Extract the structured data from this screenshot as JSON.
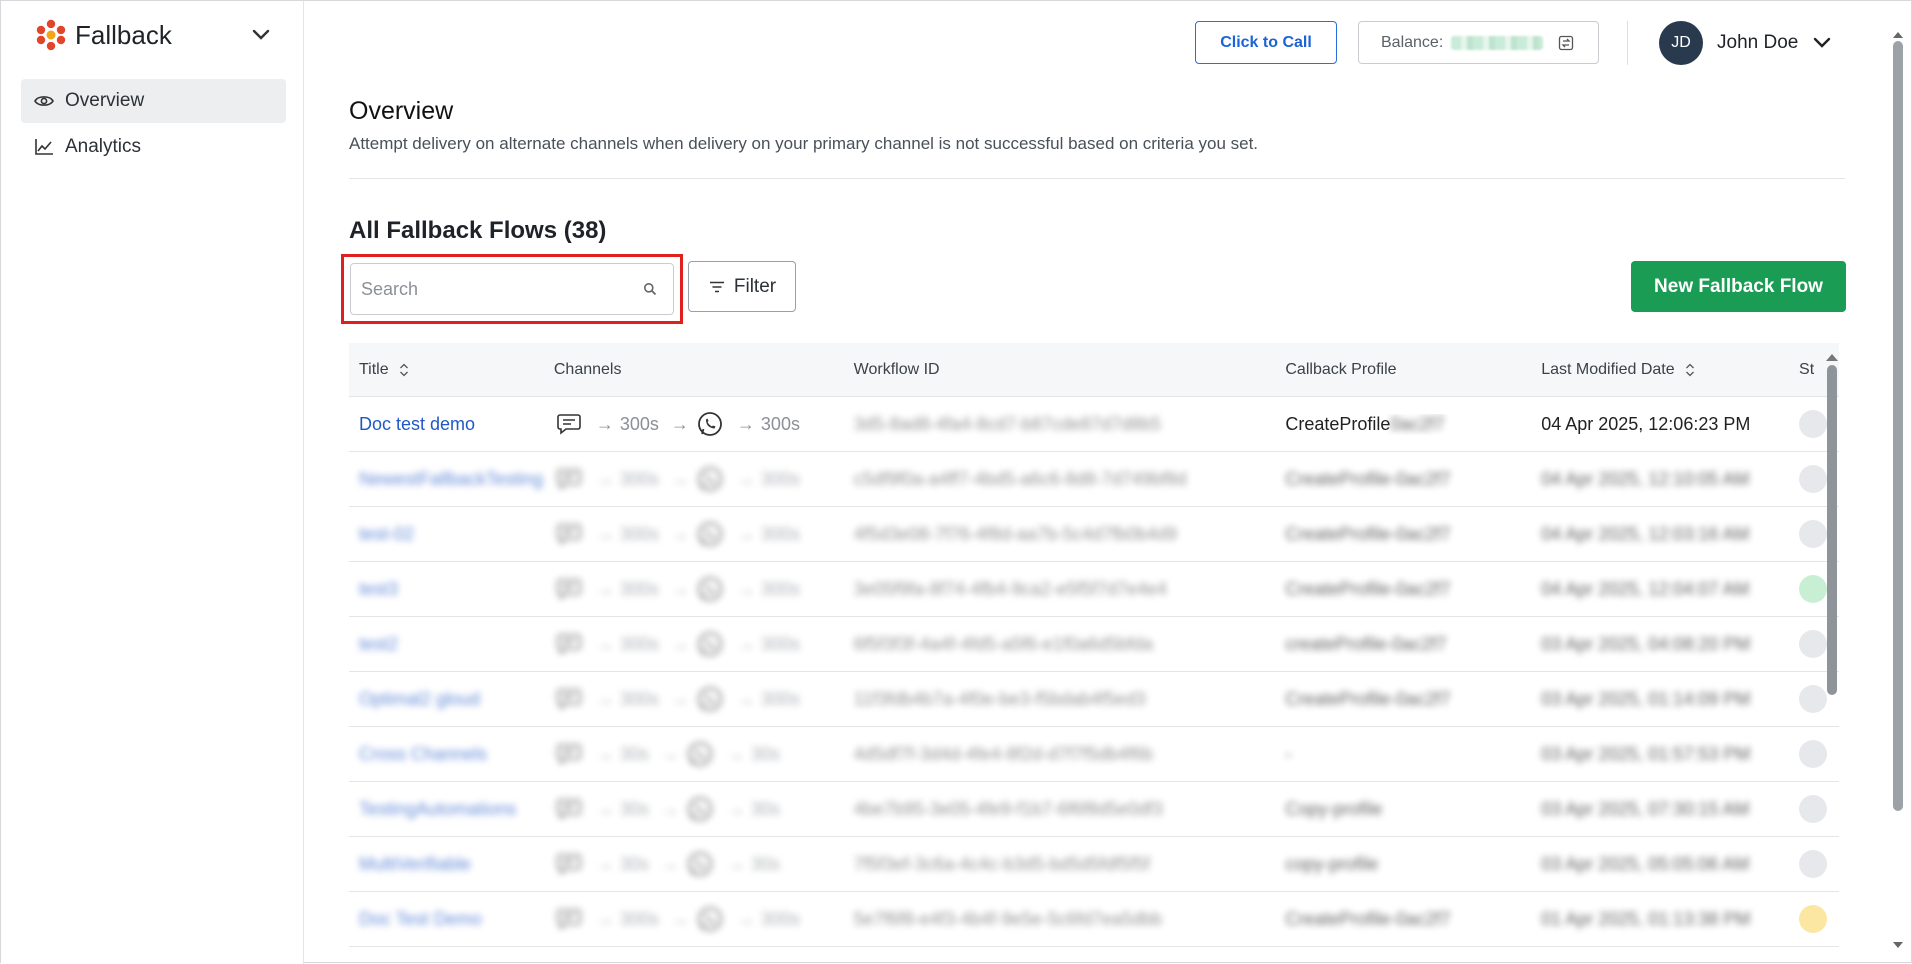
{
  "sidebar": {
    "brand": "Fallback",
    "items": [
      {
        "label": "Overview",
        "icon": "eye-icon",
        "active": true
      },
      {
        "label": "Analytics",
        "icon": "line-chart-icon",
        "active": false
      }
    ]
  },
  "header": {
    "call_label": "Click to Call",
    "balance_label": "Balance:",
    "user_initials": "JD",
    "user_name": "John Doe"
  },
  "main": {
    "title": "Overview",
    "description": "Attempt delivery on alternate channels when delivery on your primary channel is not successful based on criteria you set.",
    "section_title": "All Fallback Flows (38)",
    "search_placeholder": "Search",
    "filter_label": "Filter",
    "new_flow_label": "New Fallback Flow"
  },
  "table": {
    "columns": [
      "Title",
      "Channels",
      "Workflow ID",
      "Callback Profile",
      "Last Modified Date",
      "St"
    ],
    "rows": [
      {
        "title": "Doc test demo",
        "delay1": "300s",
        "delay2": "300s",
        "workflow_id": "3d5-8ad8-4fa4-8cd7-b87cde87d7d8b5",
        "callback": "CreateProfile",
        "callback_suffix": "0ac2f7",
        "modified": "04 Apr 2025, 12:06:23 PM",
        "status": "gray"
      },
      {
        "title": "NewestFallbackTesting",
        "delay1": "300s",
        "delay2": "300s",
        "workflow_id": "c5df9f0a-a4ff7-4bd5-a6c6-8d8-7d749bf8d",
        "callback": "CreateProfile-0ac2f7",
        "modified": "04 Apr 2025, 12:10:05 AM",
        "status": "gray"
      },
      {
        "title": "test-02",
        "delay1": "300s",
        "delay2": "300s",
        "workflow_id": "4f5d3e08-7f76-4f8d-aa7b-5c4d7fb0b4d9",
        "callback": "CreateProfile-0ac2f7",
        "modified": "04 Apr 2025, 12:03:16 AM",
        "status": "gray"
      },
      {
        "title": "test3",
        "delay1": "300s",
        "delay2": "300s",
        "workflow_id": "3e05f9fa-8f74-4fb4-9ca2-e5f5f7d7e4e4",
        "callback": "CreateProfile-0ac2f7",
        "modified": "04 Apr 2025, 12:04:07 AM",
        "status": "green"
      },
      {
        "title": "test2",
        "delay1": "300s",
        "delay2": "300s",
        "workflow_id": "6f5f3f3f-4a4f-4fd5-a5f6-e1f0a6d5bfda",
        "callback": "createProfile-0ac2f7",
        "modified": "03 Apr 2025, 04:08:20 PM",
        "status": "gray"
      },
      {
        "title": "Optimal2 gloud",
        "delay1": "300s",
        "delay2": "300s",
        "workflow_id": "11f3fdb4b7a-4f0e-be3-f5bdab4f5ed3",
        "callback": "CreateProfile-0ac2f7",
        "modified": "03 Apr 2025, 01:14:09 PM",
        "status": "gray"
      },
      {
        "title": "Cross Channels",
        "delay1": "30s",
        "delay2": "30s",
        "workflow_id": "4d5df7f-3d4d-4fe4-8f2d-d7f7f5db4f6b",
        "callback": "-",
        "modified": "03 Apr 2025, 01:57:53 PM",
        "status": "gray"
      },
      {
        "title": "TestingAutomations",
        "delay1": "30s",
        "delay2": "30s",
        "workflow_id": "4be7b95-3e05-4fe9-f1b7-6f6f8d5e0df3",
        "callback": "Copy-profile",
        "modified": "03 Apr 2025, 07:30:15 AM",
        "status": "gray"
      },
      {
        "title": "MultiVerifiable",
        "delay1": "30s",
        "delay2": "30s",
        "workflow_id": "7f5f3ef-3c6a-4c4c-b3d5-bd5d5fdf5f5f",
        "callback": "copy-profile",
        "modified": "03 Apr 2025, 05:05:06 AM",
        "status": "gray"
      },
      {
        "title": "Doc Test Demo",
        "delay1": "300s",
        "delay2": "300s",
        "workflow_id": "5e7f6f8-e4f3-4b4f-9e5e-5c6fd7ea5dbb",
        "callback": "CreateProfile-0ac2f7",
        "modified": "01 Apr 2025, 01:13:38 PM",
        "status": "yellow"
      }
    ]
  },
  "colors": {
    "accent_blue": "#1b63d6",
    "primary_green": "#1a9c54",
    "highlight_red": "#e01f1f",
    "avatar_bg": "#2a3a4e"
  }
}
